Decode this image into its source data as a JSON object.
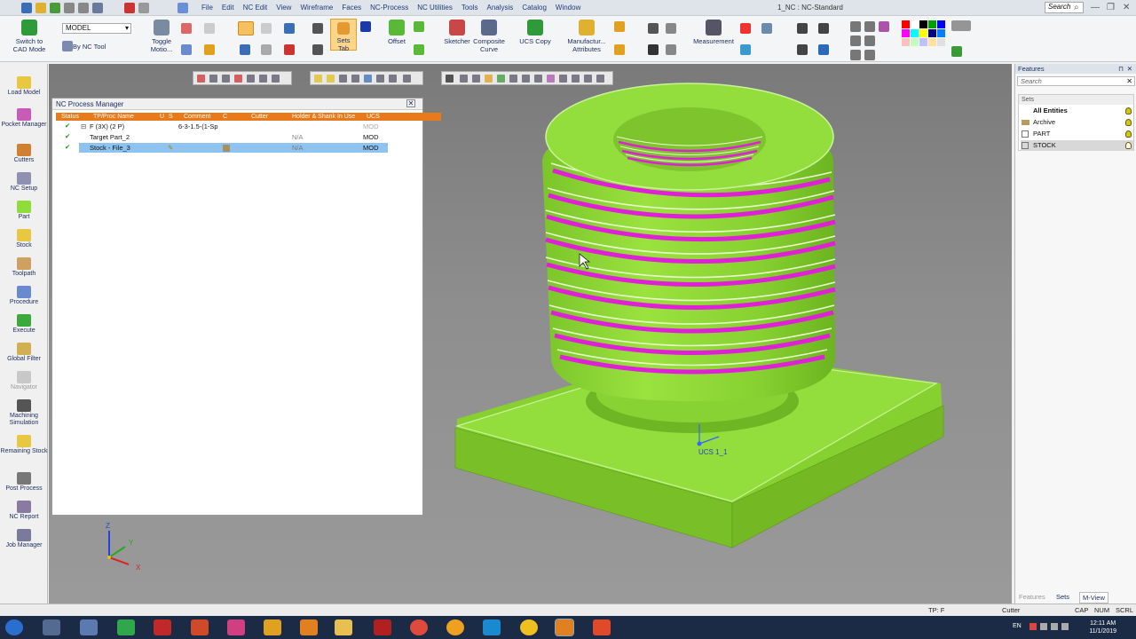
{
  "titlebar": {
    "menu": [
      "File",
      "Edit",
      "NC Edit",
      "View",
      "Wireframe",
      "Faces",
      "NC-Process",
      "NC Utilities",
      "Tools",
      "Analysis",
      "Catalog",
      "Window"
    ],
    "window_title": "1_NC : NC-Standard",
    "search_placeholder": "Search"
  },
  "ribbon": {
    "model_select": "MODEL",
    "switch_cad": "Switch to CAD Mode",
    "by_nc_tool": "By NC Tool",
    "toggle_motion": "Toggle Motio...",
    "sets_tab": "Sets Tab",
    "offset": "Offset",
    "sketcher": "Sketcher",
    "composite_curve": "Composite Curve",
    "ucs_copy": "UCS Copy",
    "manufacturing_attributes": "Manufactur... Attributes",
    "measurement": "Measurement"
  },
  "left_toolbar": [
    "Load Model",
    "Pocket Manager",
    "Cutters",
    "NC Setup",
    "Part",
    "Stock",
    "Toolpath",
    "Procedure",
    "Execute",
    "Global Filter",
    "Navigator",
    "Machining Simulation",
    "Remaining Stock",
    "Post Process",
    "NC Report",
    "Job Manager"
  ],
  "nc_process_manager": {
    "title": "NC Process Manager",
    "columns": [
      "Status",
      "TP/Proc Name",
      "U",
      "S",
      "Comment",
      "C",
      "Cutter",
      "Holder & Shank In Use",
      "UCS"
    ],
    "rows": [
      {
        "name": "F (3X) (2 P)",
        "comment": "6-3-1.5-(1-Sp",
        "cutter": "",
        "holder": "",
        "ucs": "MOD"
      },
      {
        "name": "Target Part_2",
        "comment": "",
        "cutter": "",
        "holder": "N/A",
        "ucs": "MOD"
      },
      {
        "name": "Stock - File_3",
        "comment": "",
        "cutter": "",
        "holder": "N/A",
        "ucs": "MOD"
      }
    ]
  },
  "viewport": {
    "ucs_label": "UCS 1_1",
    "axis_z": "Z",
    "axis_y": "Y",
    "axis_x": "X"
  },
  "features_panel": {
    "title": "Features",
    "search_placeholder": "Search",
    "sets_header": "Sets",
    "sets": [
      "All Entities",
      "Archive",
      "PART",
      "STOCK"
    ],
    "tabs": [
      "Features",
      "Sets",
      "M-View"
    ]
  },
  "statusbar": {
    "left": "TP: F",
    "mid": "Cutter",
    "caps": "CAP",
    "num": "NUM",
    "scrl": "SCRL"
  },
  "taskbar": {
    "lang": "EN",
    "time": "12:11 AM",
    "date": "11/1/2019"
  },
  "colors": {
    "part_green": "#8fdc3a",
    "thread_magenta": "#e020d8",
    "header_orange": "#e87a1a",
    "selection_blue": "#8ec3f0",
    "taskbar": "#1b2b45"
  }
}
